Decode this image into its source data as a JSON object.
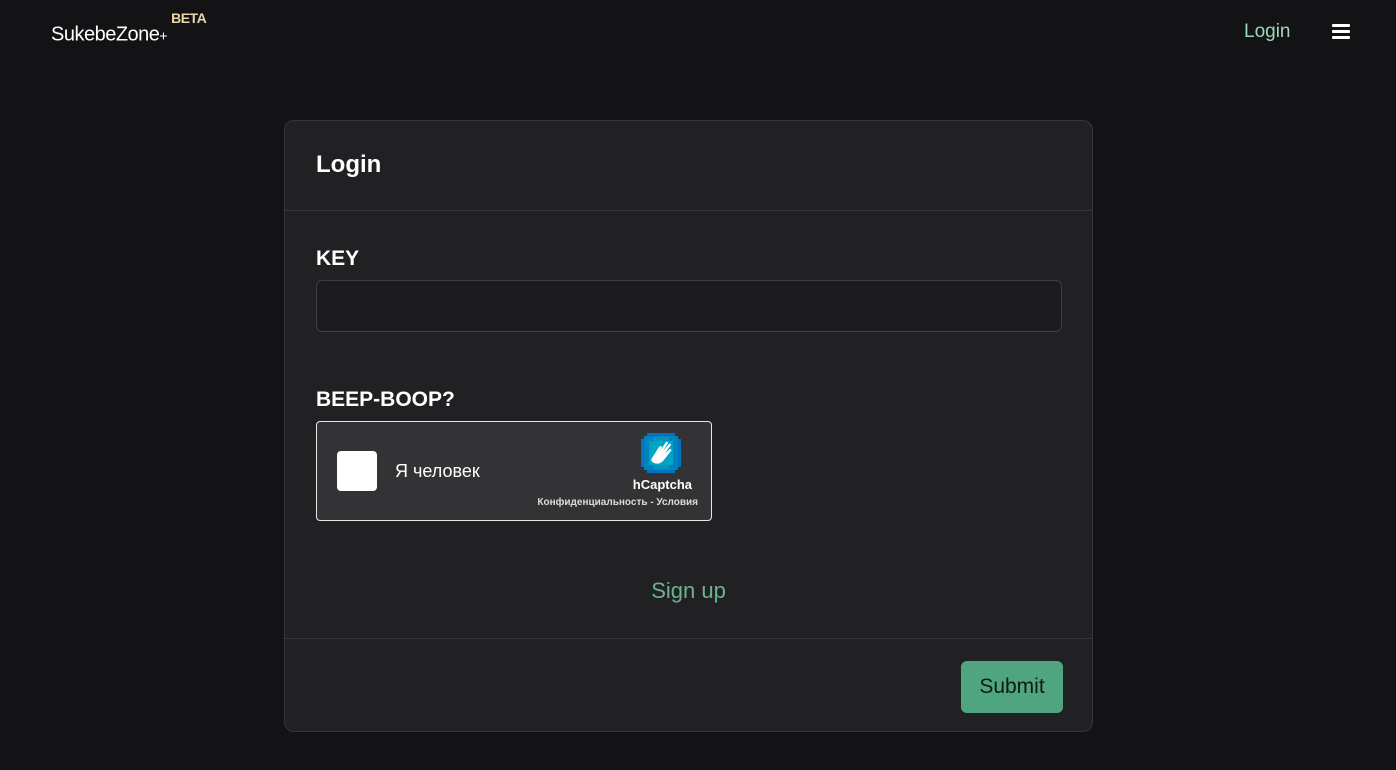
{
  "navbar": {
    "brand": "SukebeZone",
    "brand_plus": "+",
    "brand_badge": "BETA",
    "login_link": "Login",
    "menu_icon": "hamburger-menu-icon"
  },
  "login_card": {
    "title": "Login",
    "key_label": "KEY",
    "key_value": "",
    "captcha_label": "BEEP-BOOP?",
    "captcha": {
      "checkbox_text": "Я человек",
      "provider": "hCaptcha",
      "privacy_link": "Конфиденциальность",
      "separator": " - ",
      "terms_link": "Условия",
      "logo_icon": "hcaptcha-hand-icon"
    },
    "signup_link": "Sign up",
    "submit_label": "Submit"
  },
  "colors": {
    "background": "#131316",
    "card": "#212124",
    "accent_link": "#6bb38f",
    "submit": "#4fa57f",
    "beta": "#e9d6a9"
  }
}
